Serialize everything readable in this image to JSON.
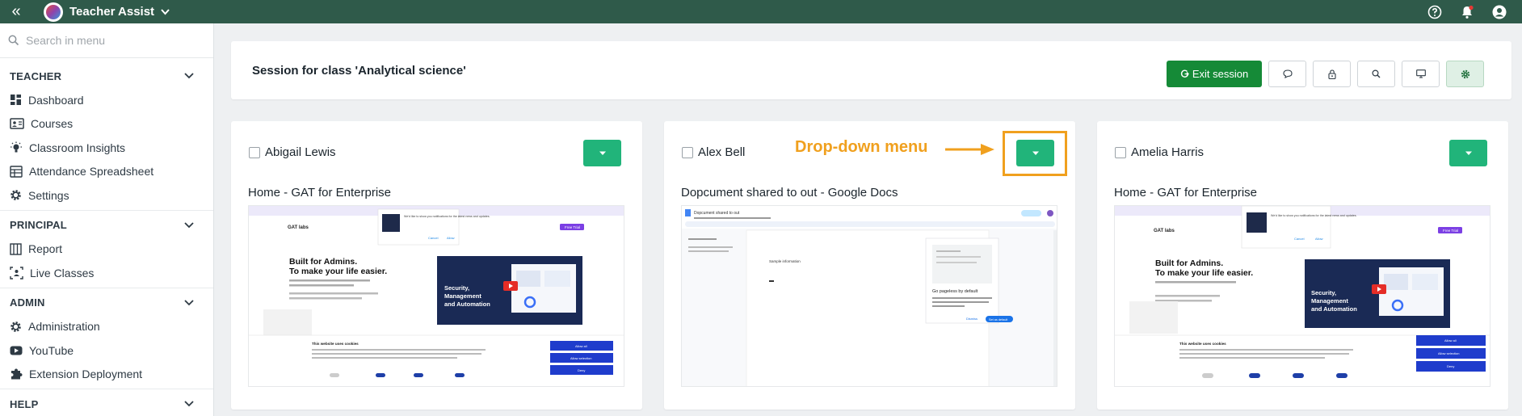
{
  "app": {
    "title": "Teacher Assist"
  },
  "search": {
    "placeholder": "Search in menu"
  },
  "sidebar": {
    "sections": [
      {
        "label": "TEACHER",
        "items": [
          {
            "label": "Dashboard",
            "icon": "dashboard-icon"
          },
          {
            "label": "Courses",
            "icon": "courses-icon"
          },
          {
            "label": "Classroom Insights",
            "icon": "lightbulb-icon"
          },
          {
            "label": "Attendance Spreadsheet",
            "icon": "spreadsheet-icon"
          },
          {
            "label": "Settings",
            "icon": "gear-icon"
          }
        ]
      },
      {
        "label": "PRINCIPAL",
        "items": [
          {
            "label": "Report",
            "icon": "report-icon"
          },
          {
            "label": "Live Classes",
            "icon": "live-classes-icon"
          }
        ]
      },
      {
        "label": "ADMIN",
        "items": [
          {
            "label": "Administration",
            "icon": "gear-icon"
          },
          {
            "label": "YouTube",
            "icon": "youtube-icon"
          },
          {
            "label": "Extension Deployment",
            "icon": "puzzle-icon"
          }
        ]
      },
      {
        "label": "HELP",
        "items": []
      }
    ]
  },
  "session": {
    "title": "Session for class 'Analytical science'",
    "exit_label": "Exit session",
    "action_icons": [
      "chat-icon",
      "lock-icon",
      "search-icon",
      "monitor-icon",
      "gear-icon"
    ]
  },
  "students": [
    {
      "name": "Abigail Lewis",
      "page_title": "Home - GAT for Enterprise"
    },
    {
      "name": "Alex Bell",
      "page_title": "Dopcument shared to out - Google Docs"
    },
    {
      "name": "Amelia Harris",
      "page_title": "Home - GAT for Enterprise"
    }
  ],
  "thumb_gat": {
    "logo": "GAT labs",
    "headline_1": "Built for Admins.",
    "headline_2": "To make your life easier.",
    "promo_1": "Security,",
    "promo_2": "Management",
    "promo_3": "and Automation",
    "cookie_title": "This website uses cookies",
    "allow_all": "Allow all",
    "allow_selection": "Allow selection",
    "deny": "Deny",
    "allow": "Allow",
    "cancel": "Cancel",
    "free_trial": "Free Trial",
    "notif": "We'd like to show you notifications for the latest news and updates."
  },
  "thumb_docs": {
    "doc_name": "Dopcument shared to out",
    "paging_title": "Go pageless by default",
    "set_default": "Set as default",
    "dismiss": "Dismiss",
    "body_text": "Sample information"
  },
  "annotation": {
    "label": "Drop-down menu"
  },
  "colors": {
    "topbar": "#2f5a4a",
    "exit": "#158a37",
    "dropdown": "#21b47a",
    "annotation": "#f0a01e"
  }
}
